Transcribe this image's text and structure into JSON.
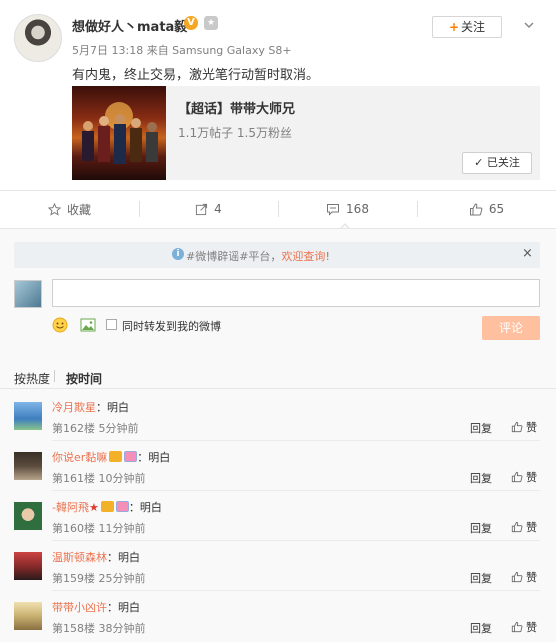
{
  "post": {
    "username": "想做好人丶mata毅",
    "verified_badge": "V",
    "meta": "5月7日 13:18 来自 Samsung Galaxy S8+",
    "text": "有内鬼，终止交易，激光笔行动暂时取消。",
    "follow_label": "关注",
    "follow_plus": "+"
  },
  "topic_card": {
    "title": "【超话】带带大师兄",
    "stats": "1.1万帖子 1.5万粉丝",
    "followed_label": "✓ 已关注"
  },
  "actions": {
    "favorite_label": "收藏",
    "repost_count": "4",
    "comment_count": "168",
    "like_count": "65"
  },
  "notice": {
    "icon": "i",
    "prefix": "#微博辟谣#平台，",
    "highlight": "欢迎查询",
    "suffix": "!",
    "close": "×"
  },
  "composer": {
    "repost_label": "同时转发到我的微博",
    "submit_label": "评论"
  },
  "sort": {
    "hot": "按热度",
    "time": "按时间"
  },
  "comments": [
    {
      "nick": "冷月欺星",
      "text": "：明白",
      "meta": "第162楼 5分钟前",
      "reply": "回复",
      "like": "赞",
      "avatar_color": "#3f7fbf"
    },
    {
      "nick": "你说er黏嘛",
      "text": "：明白",
      "meta": "第161楼 10分钟前",
      "reply": "回复",
      "like": "赞",
      "avatar_color": "#5a4b3c"
    },
    {
      "nick": "-韓阿飛",
      "text": "：明白",
      "meta": "第160楼 11分钟前",
      "reply": "回复",
      "like": "赞",
      "avatar_color": "#2f6e3f"
    },
    {
      "nick": "温斯顿森林",
      "text": "：明白",
      "meta": "第159楼 25分钟前",
      "reply": "回复",
      "like": "赞",
      "avatar_color": "#8a2a2a"
    },
    {
      "nick": "带带小凶许",
      "text": "：明白",
      "meta": "第158楼 38分钟前",
      "reply": "回复",
      "like": "赞",
      "avatar_color": "#c9b070"
    }
  ],
  "colors": {
    "accent": "#eb7350",
    "brand_orange": "#ff8200",
    "submit_disabled": "#ffc09f"
  }
}
